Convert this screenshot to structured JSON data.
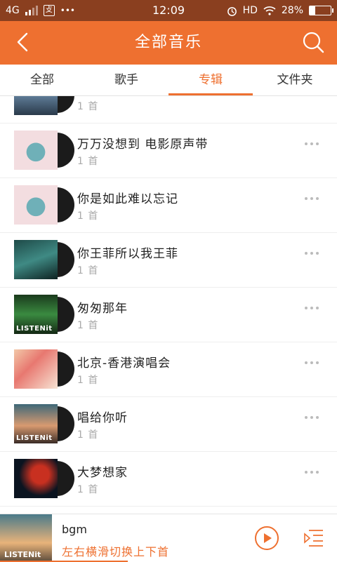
{
  "status_bar": {
    "network": "4G",
    "sim_badge": "攴",
    "dots": "•••",
    "time": "12:09",
    "hd": "HD",
    "battery": "28%",
    "battery_level": 0.28
  },
  "header": {
    "title": "全部音乐"
  },
  "tabs": [
    {
      "label": "全部"
    },
    {
      "label": "歌手"
    },
    {
      "label": "专辑"
    },
    {
      "label": "文件夹"
    }
  ],
  "active_tab": "专辑",
  "albums": [
    {
      "name": "",
      "count": "1 首",
      "art": "city"
    },
    {
      "name": "万万没想到 电影原声带",
      "count": "1 首",
      "art": "radio"
    },
    {
      "name": "你是如此难以忘记",
      "count": "1 首",
      "art": "radio"
    },
    {
      "name": "你王菲所以我王菲",
      "count": "1 首",
      "art": "teal"
    },
    {
      "name": "匆匆那年",
      "count": "1 首",
      "art": "green",
      "brand": "LISTENit"
    },
    {
      "name": "北京-香港演唱会",
      "count": "1 首",
      "art": "girl"
    },
    {
      "name": "唱给你听",
      "count": "1 首",
      "art": "sunset",
      "brand": "LISTENit"
    },
    {
      "name": "大梦想家",
      "count": "1 首",
      "art": "space"
    }
  ],
  "player": {
    "song": "bgm",
    "hint": "左右横滑切换上下首",
    "brand": "LISTENit",
    "progress": 0.38
  },
  "colors": {
    "accent": "#ee7030",
    "status_bar": "#8a3f1f"
  }
}
